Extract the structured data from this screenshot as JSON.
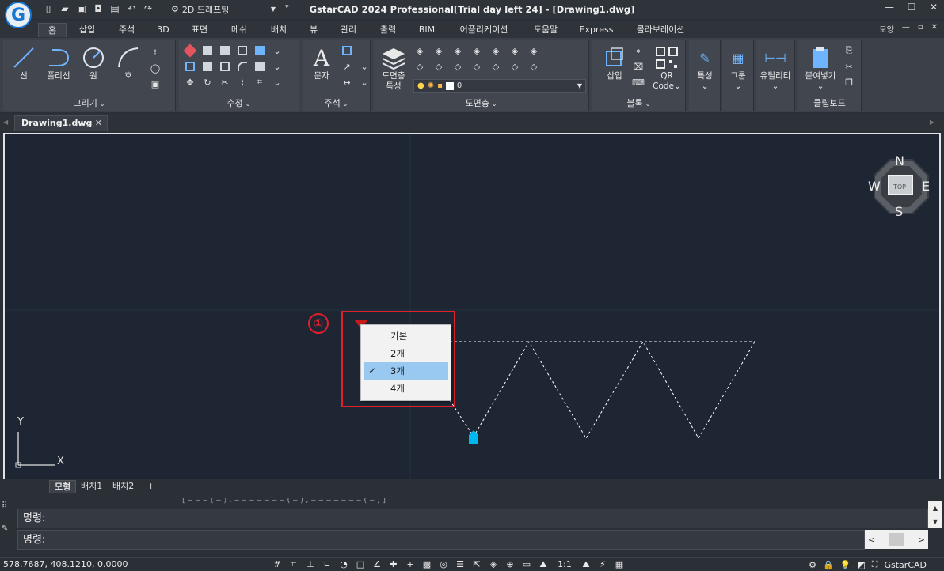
{
  "app": {
    "title": "GstarCAD 2024 Professional[Trial day left 24] - [Drawing1.dwg]",
    "logo_letter": "G",
    "workspace": "2D 드래프팅",
    "window_controls": [
      "—",
      "☐",
      "✕"
    ]
  },
  "ribbon_tabs": [
    {
      "label": "홈",
      "active": true
    },
    {
      "label": "삽입"
    },
    {
      "label": "주석"
    },
    {
      "label": "3D"
    },
    {
      "label": "표면"
    },
    {
      "label": "메쉬"
    },
    {
      "label": "배치"
    },
    {
      "label": "뷰"
    },
    {
      "label": "관리"
    },
    {
      "label": "출력"
    },
    {
      "label": "BIM"
    },
    {
      "label": "어플리케이션"
    },
    {
      "label": "도움말"
    },
    {
      "label": "Express"
    },
    {
      "label": "콜라보레이션"
    }
  ],
  "ribbon_right": {
    "style_label": "모양",
    "chevron": "v"
  },
  "panels": {
    "draw": {
      "label": "그리기",
      "buttons": {
        "line": "선",
        "polyline": "폴리선",
        "circle": "원",
        "arc": "호"
      }
    },
    "modify": {
      "label": "수정"
    },
    "annotation": {
      "label": "주석",
      "text": "문자"
    },
    "layer": {
      "label": "도면층",
      "properties": "도면층\n특성",
      "properties_line1": "도면층",
      "properties_line2": "특성",
      "current": "0"
    },
    "block": {
      "label": "블록",
      "insert": "삽입",
      "qr1": "QR",
      "qr2": "Code"
    },
    "properties": {
      "label": "특성"
    },
    "group": {
      "label": "그룹"
    },
    "utilities": {
      "label": "유틸리티"
    },
    "clipboard": {
      "label": "클립보드",
      "paste": "붙여넣기"
    }
  },
  "document": {
    "tab_label": "Drawing1.dwg"
  },
  "viewcube": {
    "n": "N",
    "s": "S",
    "e": "E",
    "w": "W",
    "face": "TOP"
  },
  "ucs": {
    "x": "X",
    "y": "Y"
  },
  "annotation_badge": "①",
  "grip_menu": {
    "items": [
      {
        "label": "기본",
        "checked": false
      },
      {
        "label": "2개",
        "checked": false
      },
      {
        "label": "3개",
        "checked": true
      },
      {
        "label": "4개",
        "checked": false
      }
    ],
    "check_glyph": "✓"
  },
  "layout_tabs": [
    {
      "label": "모형",
      "active": true
    },
    {
      "label": "배치1"
    },
    {
      "label": "배치2"
    },
    {
      "label": "+"
    }
  ],
  "command": {
    "history_line": "명령:",
    "input_prompt": "명령:",
    "faded_top": "[ ‒ ‒ ‒ ( ‒ ) , ‒ ‒ ‒ ‒ ‒ ‒ ‒ ( ‒ ) , ‒ ‒ ‒ ‒ ‒ ‒ ‒ ( ‒ ) ]"
  },
  "status": {
    "coordinates": "578.7687, 408.1210, 0.0000",
    "scale": "1:1",
    "app_name": "GstarCAD"
  },
  "colors": {
    "canvas": "#1e2633",
    "accent": "#1976d2",
    "annotation_red": "#e0202a",
    "grip_cyan": "#00b8f0",
    "menu_selected": "#99c9f1"
  }
}
